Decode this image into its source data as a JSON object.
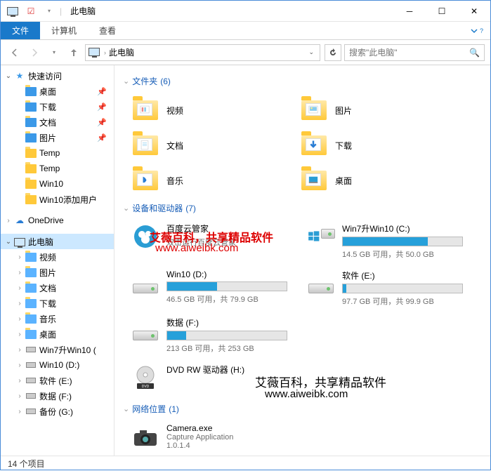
{
  "titlebar": {
    "title": "此电脑"
  },
  "ribbon": {
    "file": "文件",
    "computer": "计算机",
    "view": "查看"
  },
  "nav": {
    "address": "此电脑",
    "search_placeholder": "搜索\"此电脑\""
  },
  "sidebar": {
    "quick_access": "快速访问",
    "quick_items": [
      {
        "label": "桌面",
        "pinned": true
      },
      {
        "label": "下载",
        "pinned": true
      },
      {
        "label": "文档",
        "pinned": true
      },
      {
        "label": "图片",
        "pinned": true
      },
      {
        "label": "Temp"
      },
      {
        "label": "Temp"
      },
      {
        "label": "Win10"
      },
      {
        "label": "Win10添加用户"
      }
    ],
    "onedrive": "OneDrive",
    "this_pc": "此电脑",
    "pc_items": [
      "视频",
      "图片",
      "文档",
      "下载",
      "音乐",
      "桌面",
      "Win7升Win10 (",
      "Win10 (D:)",
      "软件 (E:)",
      "数据 (F:)",
      "备份 (G:)"
    ]
  },
  "content": {
    "folders_header": "文件夹",
    "folders_count": "(6)",
    "folders": [
      "视频",
      "图片",
      "文档",
      "下载",
      "音乐",
      "桌面"
    ],
    "devices_header": "设备和驱动器",
    "devices_count": "(7)",
    "baidu": {
      "name": "百度云管家",
      "sub": "双击运行百度云管家"
    },
    "drives": [
      {
        "name": "Win7升Win10 (C:)",
        "status": "14.5 GB 可用，共 50.0 GB",
        "fill": 71
      },
      {
        "name": "Win10 (D:)",
        "status": "46.5 GB 可用，共 79.9 GB",
        "fill": 42
      },
      {
        "name": "软件 (E:)",
        "status": "97.7 GB 可用，共 99.9 GB",
        "fill": 3
      },
      {
        "name": "数据 (F:)",
        "status": "213 GB 可用，共 253 GB",
        "fill": 16
      }
    ],
    "dvd": "DVD RW 驱动器 (H:)",
    "network_header": "网络位置",
    "network_count": "(1)",
    "camera": {
      "name": "Camera.exe",
      "sub1": "Capture Application",
      "sub2": "1.0.1.4"
    }
  },
  "watermark": {
    "w1": "艾薇百科，共享精品软件",
    "w2": "www.aiweibk.com",
    "w3": "艾薇百科，共享精品软件",
    "w4": "www.aiweibk.com"
  },
  "statusbar": {
    "items": "14 个项目"
  }
}
